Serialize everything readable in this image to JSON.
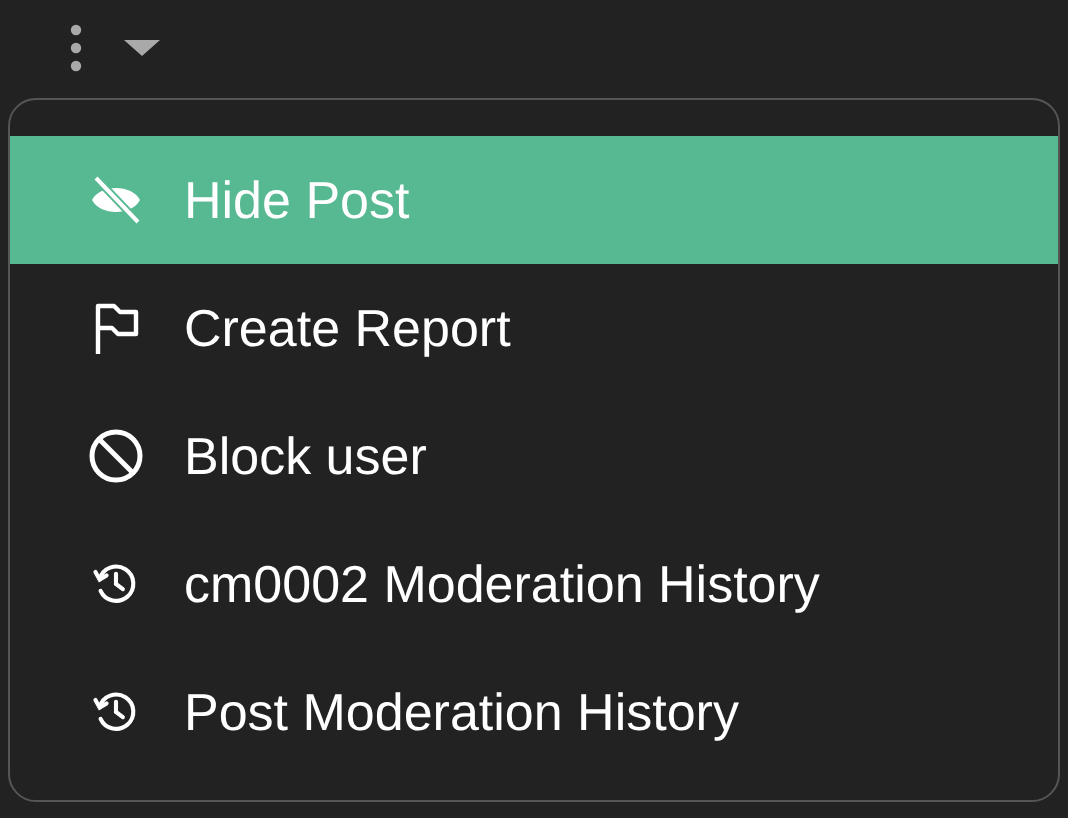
{
  "menu": {
    "items": [
      {
        "kind": "eye-slash",
        "label": "Hide Post",
        "selected": true
      },
      {
        "kind": "flag",
        "label": "Create Report",
        "selected": false
      },
      {
        "kind": "block",
        "label": "Block user",
        "selected": false
      },
      {
        "kind": "history",
        "label": "cm0002 Moderation History",
        "selected": false
      },
      {
        "kind": "history",
        "label": "Post Moderation History",
        "selected": false
      }
    ]
  }
}
